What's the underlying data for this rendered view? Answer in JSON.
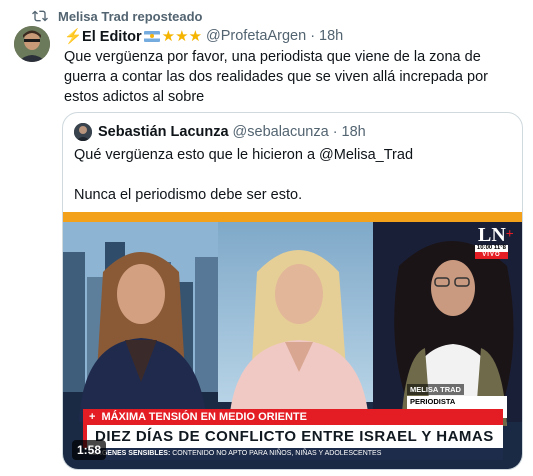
{
  "repost": {
    "label": "Melisa Trad reposteado",
    "icon": "repost-icon"
  },
  "tweet": {
    "avatar_icon": "avatar",
    "display_name_prefix": "⚡El Editor",
    "stars": "★★★",
    "handle": "@ProfetaArgen",
    "separator": "·",
    "time": "18h",
    "text": "Que vergüenza por favor, una periodista que viene de la zona de guerra a contar las dos realidades que se viven allá increpada por estos adictos al sobre"
  },
  "quote": {
    "display_name": "Sebastián Lacunza",
    "handle": "@sebalacunza",
    "separator": "·",
    "time": "18h",
    "text": "Qué vergüenza esto que le hicieron a @Melisa_Trad\n\nNunca el periodismo debe ser esto."
  },
  "video": {
    "duration": "1:58",
    "channel_logo": "LN",
    "channel_plus": "+",
    "clock": "10:00 11°8",
    "live_label": "VIVO",
    "name_tag_name": "MELISA TRAD",
    "name_tag_role": "PERIODISTA INTERNACIONALES",
    "banner_top_plus": "+",
    "banner_top": "MÁXIMA TENSIÓN EN MEDIO ORIENTE",
    "banner_main": "DIEZ DÍAS DE CONFLICTO ENTRE ISRAEL Y HAMAS",
    "banner_bottom_bold": "IMÁGENES SENSIBLES:",
    "banner_bottom": "CONTENIDO NO APTO PARA NIÑOS, NIÑAS Y ADOLESCENTES",
    "colors": {
      "accent_red": "#e41d24",
      "top_orange": "#f3a11a",
      "navy": "#1d2c4a"
    }
  }
}
